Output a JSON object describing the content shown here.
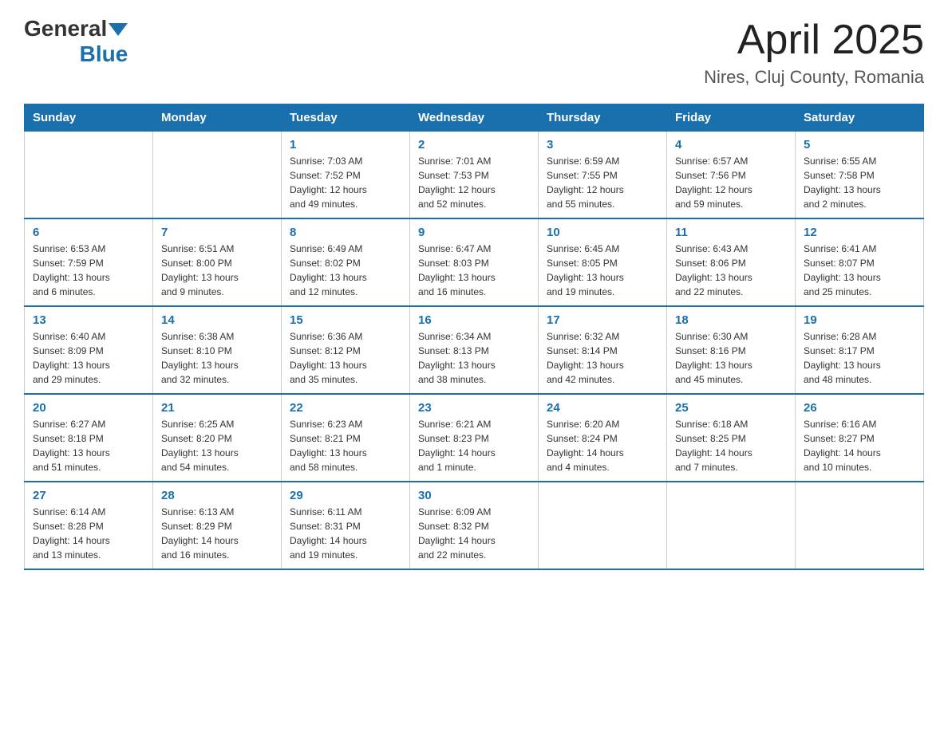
{
  "header": {
    "logo_general": "General",
    "logo_blue": "Blue",
    "title": "April 2025",
    "subtitle": "Nires, Cluj County, Romania"
  },
  "calendar": {
    "weekdays": [
      "Sunday",
      "Monday",
      "Tuesday",
      "Wednesday",
      "Thursday",
      "Friday",
      "Saturday"
    ],
    "weeks": [
      [
        {
          "day": "",
          "info": ""
        },
        {
          "day": "",
          "info": ""
        },
        {
          "day": "1",
          "info": "Sunrise: 7:03 AM\nSunset: 7:52 PM\nDaylight: 12 hours\nand 49 minutes."
        },
        {
          "day": "2",
          "info": "Sunrise: 7:01 AM\nSunset: 7:53 PM\nDaylight: 12 hours\nand 52 minutes."
        },
        {
          "day": "3",
          "info": "Sunrise: 6:59 AM\nSunset: 7:55 PM\nDaylight: 12 hours\nand 55 minutes."
        },
        {
          "day": "4",
          "info": "Sunrise: 6:57 AM\nSunset: 7:56 PM\nDaylight: 12 hours\nand 59 minutes."
        },
        {
          "day": "5",
          "info": "Sunrise: 6:55 AM\nSunset: 7:58 PM\nDaylight: 13 hours\nand 2 minutes."
        }
      ],
      [
        {
          "day": "6",
          "info": "Sunrise: 6:53 AM\nSunset: 7:59 PM\nDaylight: 13 hours\nand 6 minutes."
        },
        {
          "day": "7",
          "info": "Sunrise: 6:51 AM\nSunset: 8:00 PM\nDaylight: 13 hours\nand 9 minutes."
        },
        {
          "day": "8",
          "info": "Sunrise: 6:49 AM\nSunset: 8:02 PM\nDaylight: 13 hours\nand 12 minutes."
        },
        {
          "day": "9",
          "info": "Sunrise: 6:47 AM\nSunset: 8:03 PM\nDaylight: 13 hours\nand 16 minutes."
        },
        {
          "day": "10",
          "info": "Sunrise: 6:45 AM\nSunset: 8:05 PM\nDaylight: 13 hours\nand 19 minutes."
        },
        {
          "day": "11",
          "info": "Sunrise: 6:43 AM\nSunset: 8:06 PM\nDaylight: 13 hours\nand 22 minutes."
        },
        {
          "day": "12",
          "info": "Sunrise: 6:41 AM\nSunset: 8:07 PM\nDaylight: 13 hours\nand 25 minutes."
        }
      ],
      [
        {
          "day": "13",
          "info": "Sunrise: 6:40 AM\nSunset: 8:09 PM\nDaylight: 13 hours\nand 29 minutes."
        },
        {
          "day": "14",
          "info": "Sunrise: 6:38 AM\nSunset: 8:10 PM\nDaylight: 13 hours\nand 32 minutes."
        },
        {
          "day": "15",
          "info": "Sunrise: 6:36 AM\nSunset: 8:12 PM\nDaylight: 13 hours\nand 35 minutes."
        },
        {
          "day": "16",
          "info": "Sunrise: 6:34 AM\nSunset: 8:13 PM\nDaylight: 13 hours\nand 38 minutes."
        },
        {
          "day": "17",
          "info": "Sunrise: 6:32 AM\nSunset: 8:14 PM\nDaylight: 13 hours\nand 42 minutes."
        },
        {
          "day": "18",
          "info": "Sunrise: 6:30 AM\nSunset: 8:16 PM\nDaylight: 13 hours\nand 45 minutes."
        },
        {
          "day": "19",
          "info": "Sunrise: 6:28 AM\nSunset: 8:17 PM\nDaylight: 13 hours\nand 48 minutes."
        }
      ],
      [
        {
          "day": "20",
          "info": "Sunrise: 6:27 AM\nSunset: 8:18 PM\nDaylight: 13 hours\nand 51 minutes."
        },
        {
          "day": "21",
          "info": "Sunrise: 6:25 AM\nSunset: 8:20 PM\nDaylight: 13 hours\nand 54 minutes."
        },
        {
          "day": "22",
          "info": "Sunrise: 6:23 AM\nSunset: 8:21 PM\nDaylight: 13 hours\nand 58 minutes."
        },
        {
          "day": "23",
          "info": "Sunrise: 6:21 AM\nSunset: 8:23 PM\nDaylight: 14 hours\nand 1 minute."
        },
        {
          "day": "24",
          "info": "Sunrise: 6:20 AM\nSunset: 8:24 PM\nDaylight: 14 hours\nand 4 minutes."
        },
        {
          "day": "25",
          "info": "Sunrise: 6:18 AM\nSunset: 8:25 PM\nDaylight: 14 hours\nand 7 minutes."
        },
        {
          "day": "26",
          "info": "Sunrise: 6:16 AM\nSunset: 8:27 PM\nDaylight: 14 hours\nand 10 minutes."
        }
      ],
      [
        {
          "day": "27",
          "info": "Sunrise: 6:14 AM\nSunset: 8:28 PM\nDaylight: 14 hours\nand 13 minutes."
        },
        {
          "day": "28",
          "info": "Sunrise: 6:13 AM\nSunset: 8:29 PM\nDaylight: 14 hours\nand 16 minutes."
        },
        {
          "day": "29",
          "info": "Sunrise: 6:11 AM\nSunset: 8:31 PM\nDaylight: 14 hours\nand 19 minutes."
        },
        {
          "day": "30",
          "info": "Sunrise: 6:09 AM\nSunset: 8:32 PM\nDaylight: 14 hours\nand 22 minutes."
        },
        {
          "day": "",
          "info": ""
        },
        {
          "day": "",
          "info": ""
        },
        {
          "day": "",
          "info": ""
        }
      ]
    ]
  }
}
